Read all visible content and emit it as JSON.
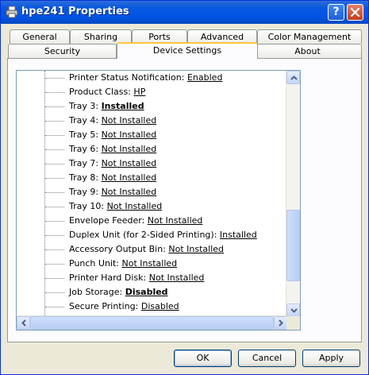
{
  "window": {
    "title": "hpe241 Properties",
    "help_label": "?",
    "close_label": "close"
  },
  "tabs_row1": [
    "General",
    "Sharing",
    "Ports",
    "Advanced",
    "Color Management"
  ],
  "tabs_row2": [
    "Security",
    "Device Settings",
    "About"
  ],
  "active_tab": "Device Settings",
  "settings": [
    {
      "label": "Printer Status Notification:",
      "value": "Enabled",
      "bold": false
    },
    {
      "label": "Product Class:",
      "value": "HP",
      "bold": false
    },
    {
      "label": "Tray 3:",
      "value": "Installed",
      "bold": true
    },
    {
      "label": "Tray 4:",
      "value": "Not Installed",
      "bold": false
    },
    {
      "label": "Tray 5:",
      "value": "Not Installed",
      "bold": false
    },
    {
      "label": "Tray 6:",
      "value": "Not Installed",
      "bold": false
    },
    {
      "label": "Tray 7:",
      "value": "Not Installed",
      "bold": false
    },
    {
      "label": "Tray 8:",
      "value": "Not Installed",
      "bold": false
    },
    {
      "label": "Tray 9:",
      "value": "Not Installed",
      "bold": false
    },
    {
      "label": "Tray 10:",
      "value": "Not Installed",
      "bold": false
    },
    {
      "label": "Envelope Feeder:",
      "value": "Not Installed",
      "bold": false
    },
    {
      "label": "Duplex Unit (for 2-Sided Printing):",
      "value": "Installed",
      "bold": false
    },
    {
      "label": "Accessory Output Bin:",
      "value": "Not Installed",
      "bold": false
    },
    {
      "label": "Punch Unit:",
      "value": "Not Installed",
      "bold": false
    },
    {
      "label": "Printer Hard Disk:",
      "value": "Not Installed",
      "bold": false
    },
    {
      "label": "Job Storage:",
      "value": "Disabled",
      "bold": true
    },
    {
      "label": "Secure Printing:",
      "value": "Disabled",
      "bold": false
    }
  ],
  "buttons": {
    "ok": "OK",
    "cancel": "Cancel",
    "apply": "Apply"
  },
  "colors": {
    "titlebar": "#0054e3",
    "dialog_bg": "#ece9d8",
    "active_tab_accent": "#ffc83c"
  }
}
